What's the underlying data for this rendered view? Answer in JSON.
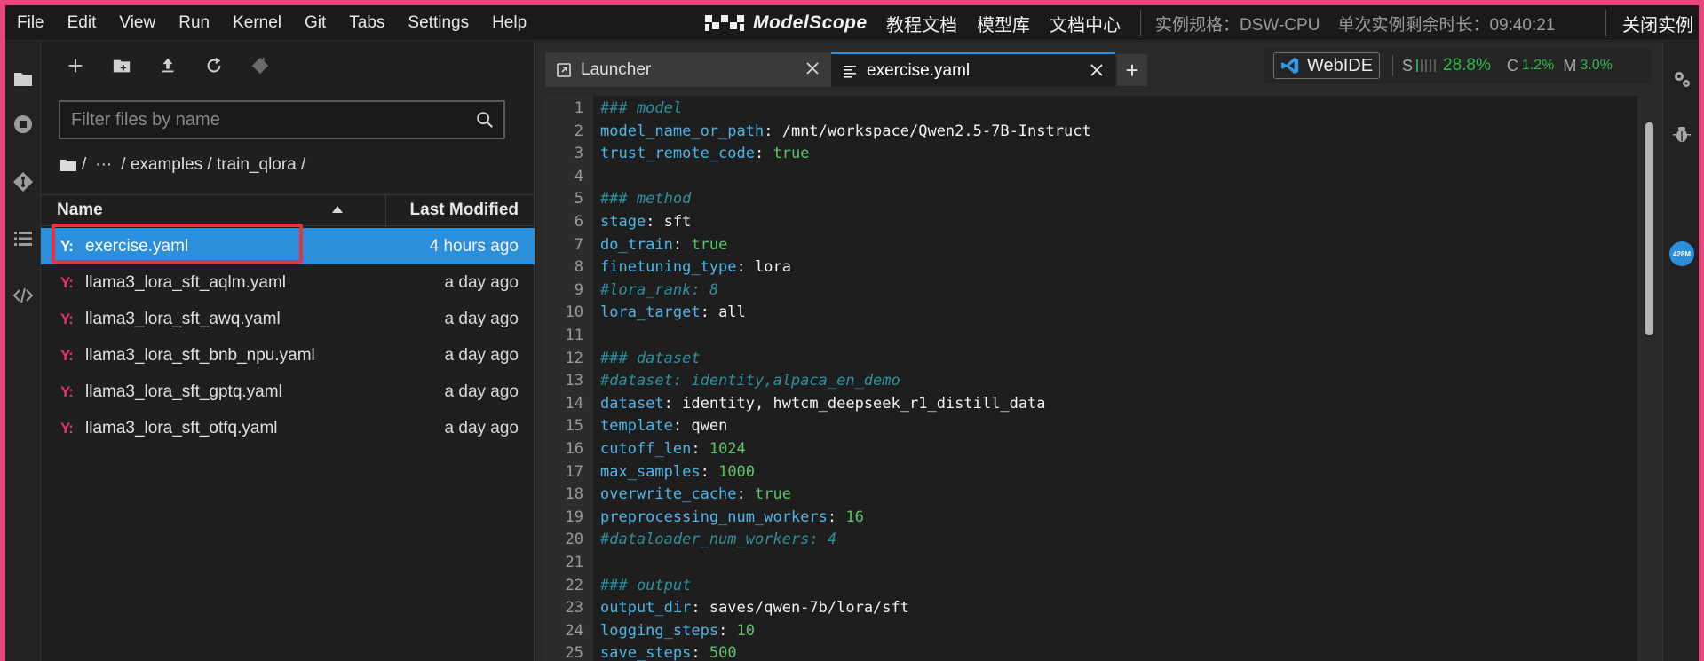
{
  "menu": [
    "File",
    "Edit",
    "View",
    "Run",
    "Kernel",
    "Git",
    "Tabs",
    "Settings",
    "Help"
  ],
  "brand": "ModelScope",
  "top_links": [
    "教程文档",
    "模型库",
    "文档中心"
  ],
  "instance_spec": "实例规格：DSW-CPU",
  "remaining_time": "单次实例剩余时长：09:40:21",
  "close_instance": "关闭实例",
  "filter_placeholder": "Filter files by name",
  "breadcrumb": [
    "/",
    "···",
    "/ examples / train_qlora /"
  ],
  "file_header": {
    "name": "Name",
    "modified": "Last Modified"
  },
  "files": [
    {
      "name": "exercise.yaml",
      "modified": "4 hours ago",
      "icon": "Y:"
    },
    {
      "name": "llama3_lora_sft_aqlm.yaml",
      "modified": "a day ago",
      "icon": "Y:"
    },
    {
      "name": "llama3_lora_sft_awq.yaml",
      "modified": "a day ago",
      "icon": "Y:"
    },
    {
      "name": "llama3_lora_sft_bnb_npu.yaml",
      "modified": "a day ago",
      "icon": "Y:"
    },
    {
      "name": "llama3_lora_sft_gptq.yaml",
      "modified": "a day ago",
      "icon": "Y:"
    },
    {
      "name": "llama3_lora_sft_otfq.yaml",
      "modified": "a day ago",
      "icon": "Y:"
    }
  ],
  "tabs": [
    {
      "label": "Launcher"
    },
    {
      "label": "exercise.yaml"
    }
  ],
  "status": {
    "webide": "WebIDE",
    "s_label": "S",
    "s_value": "28.8%",
    "c_label": "C",
    "c_value": "1.2%",
    "m_label": "M",
    "m_value": "3.0%"
  },
  "memory_badge": "428M",
  "code_lines": [
    [
      [
        "c",
        "### model"
      ]
    ],
    [
      [
        "k",
        "model_name_or_path"
      ],
      [
        "v",
        ": /mnt/workspace/Qwen2.5-7B-Instruct"
      ]
    ],
    [
      [
        "k",
        "trust_remote_code"
      ],
      [
        "v",
        ": "
      ],
      [
        "b",
        "true"
      ]
    ],
    [],
    [
      [
        "c",
        "### method"
      ]
    ],
    [
      [
        "k",
        "stage"
      ],
      [
        "v",
        ": sft"
      ]
    ],
    [
      [
        "k",
        "do_train"
      ],
      [
        "v",
        ": "
      ],
      [
        "b",
        "true"
      ]
    ],
    [
      [
        "k",
        "finetuning_type"
      ],
      [
        "v",
        ": lora"
      ]
    ],
    [
      [
        "c",
        "#lora_rank: 8"
      ]
    ],
    [
      [
        "k",
        "lora_target"
      ],
      [
        "v",
        ": all"
      ]
    ],
    [],
    [
      [
        "c",
        "### dataset"
      ]
    ],
    [
      [
        "c",
        "#dataset: identity,alpaca_en_demo"
      ]
    ],
    [
      [
        "k",
        "dataset"
      ],
      [
        "v",
        ": identity, hwtcm_deepseek_r1_distill_data"
      ]
    ],
    [
      [
        "k",
        "template"
      ],
      [
        "v",
        ": qwen"
      ]
    ],
    [
      [
        "k",
        "cutoff_len"
      ],
      [
        "v",
        ": "
      ],
      [
        "n",
        "1024"
      ]
    ],
    [
      [
        "k",
        "max_samples"
      ],
      [
        "v",
        ": "
      ],
      [
        "n",
        "1000"
      ]
    ],
    [
      [
        "k",
        "overwrite_cache"
      ],
      [
        "v",
        ": "
      ],
      [
        "b",
        "true"
      ]
    ],
    [
      [
        "k",
        "preprocessing_num_workers"
      ],
      [
        "v",
        ": "
      ],
      [
        "n",
        "16"
      ]
    ],
    [
      [
        "c",
        "#dataloader_num_workers: 4"
      ]
    ],
    [],
    [
      [
        "c",
        "### output"
      ]
    ],
    [
      [
        "k",
        "output_dir"
      ],
      [
        "v",
        ": saves/qwen-7b/lora/sft"
      ]
    ],
    [
      [
        "k",
        "logging_steps"
      ],
      [
        "v",
        ": "
      ],
      [
        "n",
        "10"
      ]
    ],
    [
      [
        "k",
        "save_steps"
      ],
      [
        "v",
        ": "
      ],
      [
        "n",
        "500"
      ]
    ]
  ]
}
